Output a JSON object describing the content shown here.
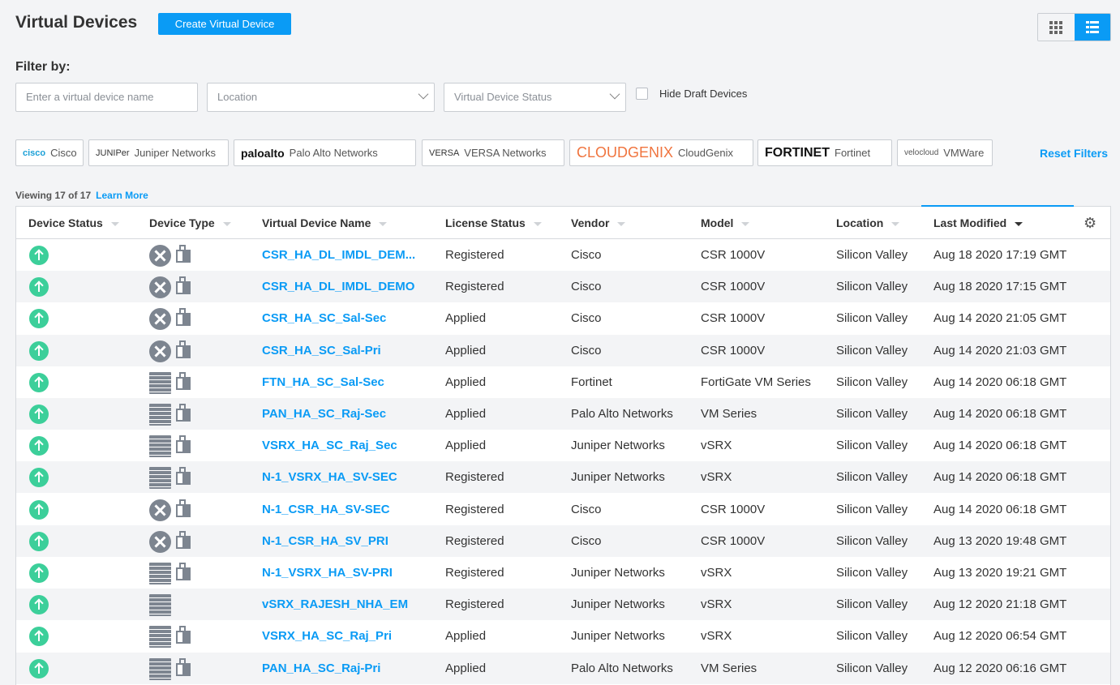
{
  "header": {
    "title": "Virtual Devices",
    "create_label": "Create Virtual Device"
  },
  "filters": {
    "label": "Filter by:",
    "name_placeholder": "Enter a virtual device name",
    "location_placeholder": "Location",
    "status_placeholder": "Virtual Device Status",
    "hide_draft_label": "Hide Draft Devices"
  },
  "vendors": [
    {
      "logo": "cisco",
      "label": "Cisco"
    },
    {
      "logo": "JUNIPer",
      "label": "Juniper Networks"
    },
    {
      "logo": "paloalto",
      "label": "Palo Alto Networks"
    },
    {
      "logo": "VERSA",
      "label": "VERSA Networks"
    },
    {
      "logo": "CLOUDGENIX",
      "label": "CloudGenix"
    },
    {
      "logo": "FORTINET",
      "label": "Fortinet"
    },
    {
      "logo": "velocloud",
      "label": "VMWare"
    }
  ],
  "reset_label": "Reset Filters",
  "viewing": {
    "text": "Viewing 17 of 17",
    "learn_more": "Learn More"
  },
  "columns": [
    "Device Status",
    "Device Type",
    "Virtual Device Name",
    "License Status",
    "Vendor",
    "Model",
    "Location",
    "Last Modified"
  ],
  "rows": [
    {
      "type": "router",
      "license_icon": true,
      "name": "CSR_HA_DL_IMDL_DEM...",
      "license": "Registered",
      "vendor": "Cisco",
      "model": "CSR 1000V",
      "location": "Silicon Valley",
      "modified": "Aug 18 2020 17:19 GMT"
    },
    {
      "type": "router",
      "license_icon": true,
      "name": "CSR_HA_DL_IMDL_DEMO",
      "license": "Registered",
      "vendor": "Cisco",
      "model": "CSR 1000V",
      "location": "Silicon Valley",
      "modified": "Aug 18 2020 17:15 GMT"
    },
    {
      "type": "router",
      "license_icon": true,
      "name": "CSR_HA_SC_Sal-Sec",
      "license": "Applied",
      "vendor": "Cisco",
      "model": "CSR 1000V",
      "location": "Silicon Valley",
      "modified": "Aug 14 2020 21:05 GMT"
    },
    {
      "type": "router",
      "license_icon": true,
      "name": "CSR_HA_SC_Sal-Pri",
      "license": "Applied",
      "vendor": "Cisco",
      "model": "CSR 1000V",
      "location": "Silicon Valley",
      "modified": "Aug 14 2020 21:03 GMT"
    },
    {
      "type": "firewall",
      "license_icon": true,
      "name": "FTN_HA_SC_Sal-Sec",
      "license": "Applied",
      "vendor": "Fortinet",
      "model": "FortiGate VM Series",
      "location": "Silicon Valley",
      "modified": "Aug 14 2020 06:18 GMT"
    },
    {
      "type": "firewall",
      "license_icon": true,
      "name": "PAN_HA_SC_Raj-Sec",
      "license": "Applied",
      "vendor": "Palo Alto Networks",
      "model": "VM Series",
      "location": "Silicon Valley",
      "modified": "Aug 14 2020 06:18 GMT"
    },
    {
      "type": "firewall",
      "license_icon": true,
      "name": "VSRX_HA_SC_Raj_Sec",
      "license": "Applied",
      "vendor": "Juniper Networks",
      "model": "vSRX",
      "location": "Silicon Valley",
      "modified": "Aug 14 2020 06:18 GMT"
    },
    {
      "type": "firewall",
      "license_icon": true,
      "name": "N-1_VSRX_HA_SV-SEC",
      "license": "Registered",
      "vendor": "Juniper Networks",
      "model": "vSRX",
      "location": "Silicon Valley",
      "modified": "Aug 14 2020 06:18 GMT"
    },
    {
      "type": "router",
      "license_icon": true,
      "name": "N-1_CSR_HA_SV-SEC",
      "license": "Registered",
      "vendor": "Cisco",
      "model": "CSR 1000V",
      "location": "Silicon Valley",
      "modified": "Aug 14 2020 06:18 GMT"
    },
    {
      "type": "router",
      "license_icon": true,
      "name": "N-1_CSR_HA_SV_PRI",
      "license": "Registered",
      "vendor": "Cisco",
      "model": "CSR 1000V",
      "location": "Silicon Valley",
      "modified": "Aug 13 2020 19:48 GMT"
    },
    {
      "type": "firewall",
      "license_icon": true,
      "name": "N-1_VSRX_HA_SV-PRI",
      "license": "Registered",
      "vendor": "Juniper Networks",
      "model": "vSRX",
      "location": "Silicon Valley",
      "modified": "Aug 13 2020 19:21 GMT"
    },
    {
      "type": "firewall",
      "license_icon": false,
      "name": "vSRX_RAJESH_NHA_EM",
      "license": "Registered",
      "vendor": "Juniper Networks",
      "model": "vSRX",
      "location": "Silicon Valley",
      "modified": "Aug 12 2020 21:18 GMT"
    },
    {
      "type": "firewall",
      "license_icon": true,
      "name": "VSRX_HA_SC_Raj_Pri",
      "license": "Applied",
      "vendor": "Juniper Networks",
      "model": "vSRX",
      "location": "Silicon Valley",
      "modified": "Aug 12 2020 06:54 GMT"
    },
    {
      "type": "firewall",
      "license_icon": true,
      "name": "PAN_HA_SC_Raj-Pri",
      "license": "Applied",
      "vendor": "Palo Alto Networks",
      "model": "VM Series",
      "location": "Silicon Valley",
      "modified": "Aug 12 2020 06:16 GMT"
    }
  ]
}
